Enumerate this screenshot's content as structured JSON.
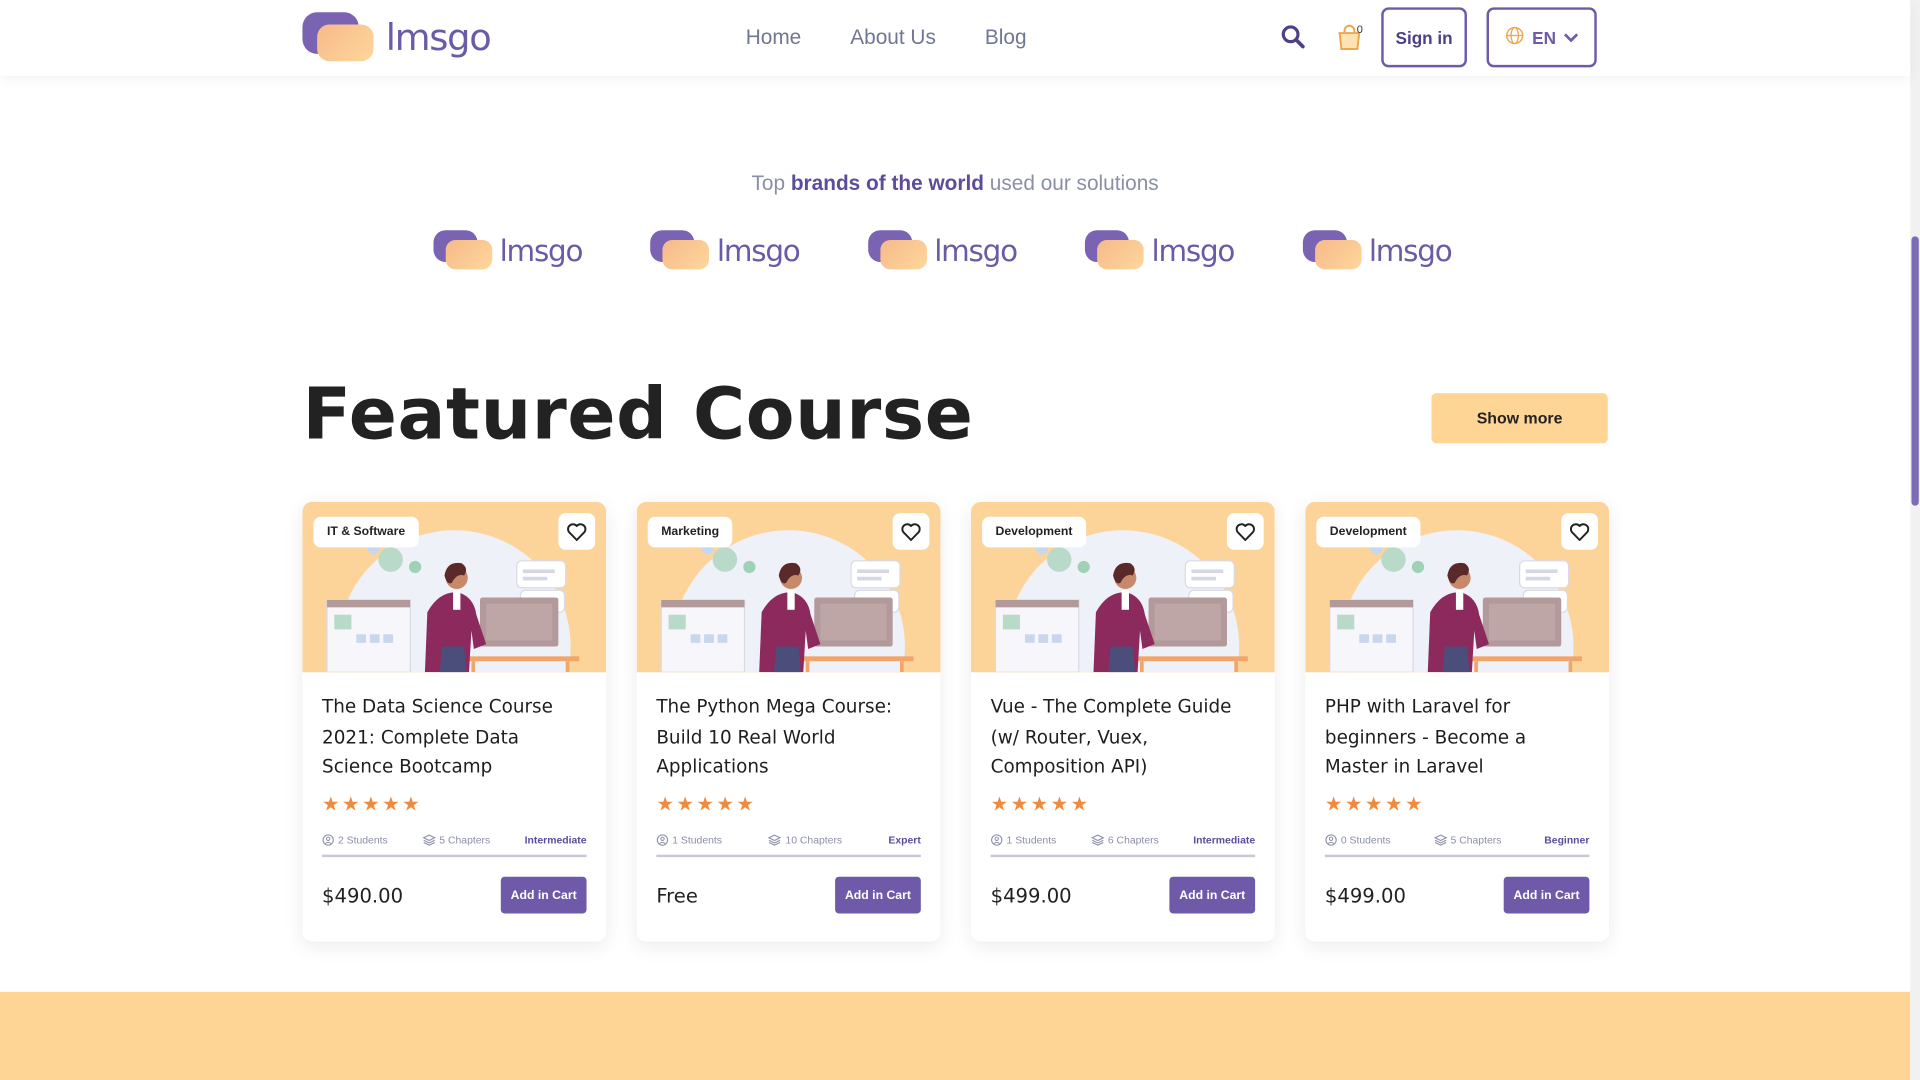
{
  "header": {
    "logo_text": "lmsgo",
    "nav": [
      "Home",
      "About Us",
      "Blog"
    ],
    "cart_count": "0",
    "signin_label": "Sign in",
    "lang_label": "EN"
  },
  "brands": {
    "title_pre": "Top ",
    "title_bold": "brands of the world",
    "title_post": " used our solutions",
    "logos": [
      "lmsgo",
      "lmsgo",
      "lmsgo",
      "lmsgo",
      "lmsgo"
    ]
  },
  "featured": {
    "title": "Featured Course",
    "show_more": "Show more",
    "courses": [
      {
        "category": "IT & Software",
        "title": "The Data Science Course 2021: Complete Data Science Bootcamp",
        "rating": 5,
        "students": "2 Students",
        "chapters": "5 Chapters",
        "level": "Intermediate",
        "price": "$490.00",
        "cart": "Add in Cart"
      },
      {
        "category": "Marketing",
        "title": "The Python Mega Course: Build 10 Real World Applications",
        "rating": 5,
        "students": "1 Students",
        "chapters": "10 Chapters",
        "level": "Expert",
        "price": "Free",
        "cart": "Add in Cart"
      },
      {
        "category": "Development",
        "title": "Vue - The Complete Guide (w/ Router, Vuex, Composition API)",
        "rating": 5,
        "students": "1 Students",
        "chapters": "6 Chapters",
        "level": "Intermediate",
        "price": "$499.00",
        "cart": "Add in Cart"
      },
      {
        "category": "Development",
        "title": "PHP with Laravel for beginners - Become a Master in Laravel",
        "rating": 5,
        "students": "0 Students",
        "chapters": "5 Chapters",
        "level": "Beginner",
        "price": "$499.00",
        "cart": "Add in Cart"
      }
    ]
  },
  "colors": {
    "brand_purple": "#6e5aa8",
    "accent_peach": "#ffd595",
    "star_orange": "#f08a3c"
  }
}
